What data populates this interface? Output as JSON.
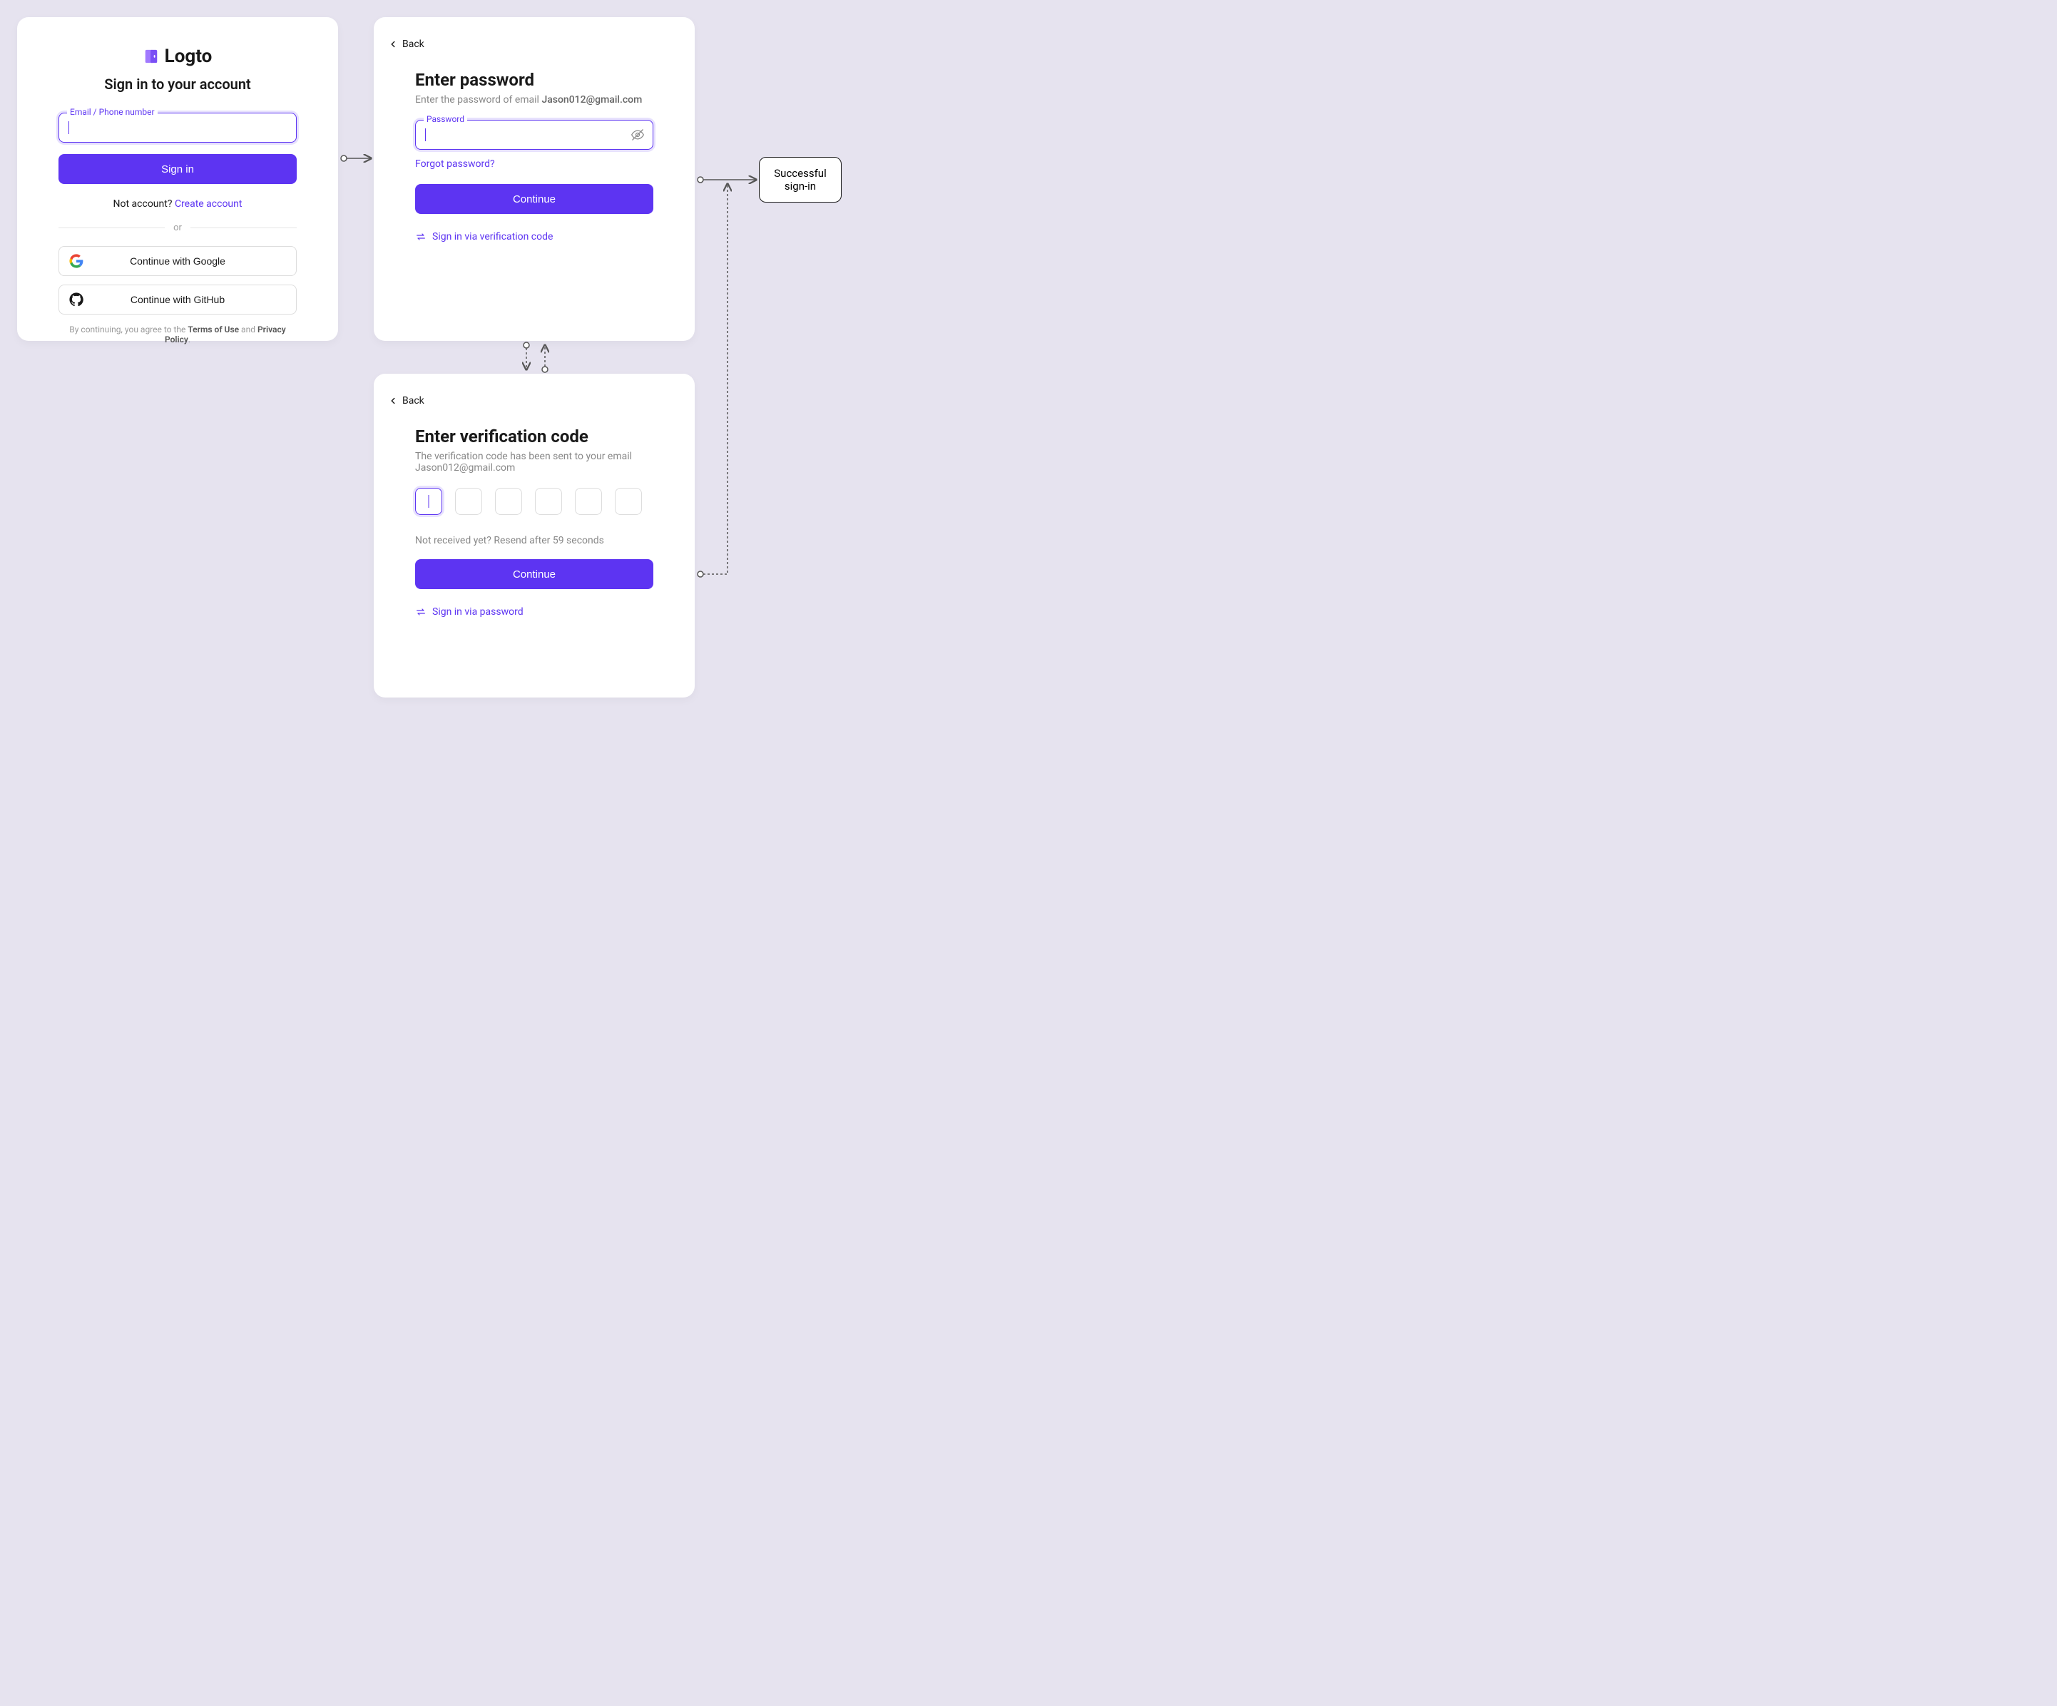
{
  "brand": "Logto",
  "signin": {
    "title": "Sign in to your account",
    "input_label": "Email / Phone number",
    "button": "Sign in",
    "no_account": "Not account? ",
    "create_link": "Create account",
    "divider": "or",
    "google": "Continue with Google",
    "github": "Continue with GitHub",
    "legal_pre": "By continuing, you agree to the ",
    "terms": "Terms of Use",
    "legal_mid": " and ",
    "privacy": "Privacy Policy",
    "legal_end": "."
  },
  "password": {
    "back": "Back",
    "title": "Enter password",
    "subtitle_pre": "Enter the password of email ",
    "email": "Jason012@gmail.com",
    "field_label": "Password",
    "forgot": "Forgot password?",
    "continue": "Continue",
    "alt_link": "Sign in via verification code"
  },
  "verify": {
    "back": "Back",
    "title": "Enter verification code",
    "subtitle_pre": "The verification code has been sent to your email ",
    "email": "Jason012@gmail.com",
    "resend": "Not received yet? Resend after 59 seconds",
    "continue": "Continue",
    "alt_link": "Sign in via password"
  },
  "result": "Successful sign-in"
}
